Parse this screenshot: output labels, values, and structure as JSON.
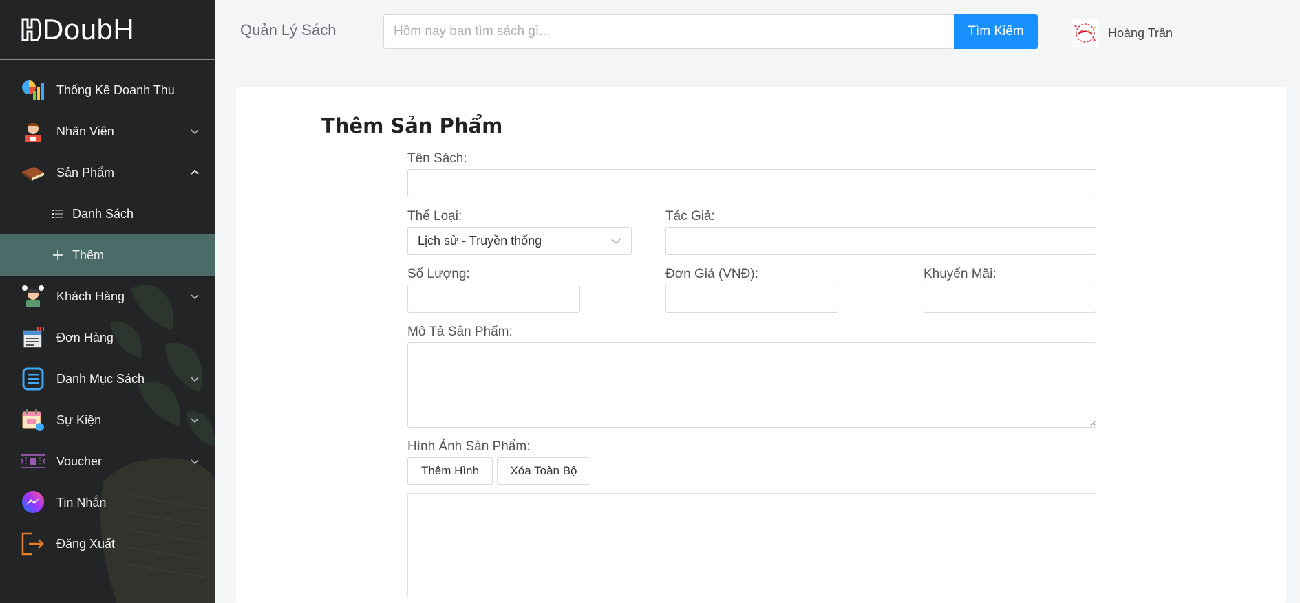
{
  "brand": {
    "name": "DoubH"
  },
  "sidebar": {
    "items": [
      {
        "label": "Thống Kê Doanh Thu",
        "icon": "chart-stats-icon",
        "has_chevron": false
      },
      {
        "label": "Nhân Viên",
        "icon": "employee-icon",
        "has_chevron": true,
        "chevron": "down"
      },
      {
        "label": "Sản Phẩm",
        "icon": "book-icon",
        "has_chevron": true,
        "chevron": "up"
      },
      {
        "label": "Khách Hàng",
        "icon": "customer-icon",
        "has_chevron": true,
        "chevron": "down"
      },
      {
        "label": "Đơn Hàng",
        "icon": "order-icon",
        "has_chevron": false
      },
      {
        "label": "Danh Mục Sách",
        "icon": "list-document-icon",
        "has_chevron": true,
        "chevron": "down"
      },
      {
        "label": "Sự Kiện",
        "icon": "calendar-event-icon",
        "has_chevron": true,
        "chevron": "down"
      },
      {
        "label": "Voucher",
        "icon": "ticket-icon",
        "has_chevron": true,
        "chevron": "down"
      },
      {
        "label": "Tin Nhắn",
        "icon": "messenger-icon",
        "has_chevron": false
      },
      {
        "label": "Đăng Xuất",
        "icon": "logout-icon",
        "has_chevron": false
      }
    ],
    "subitems": [
      {
        "label": "Danh Sách",
        "icon": "list-icon",
        "active": false
      },
      {
        "label": "Thêm",
        "icon": "plus-icon",
        "active": true
      }
    ],
    "active_color": "#4a6b68",
    "background": "#232426"
  },
  "header": {
    "title": "Quản Lý Sách",
    "search_placeholder": "Hôm nay bạn tìm sách gì...",
    "search_value": "",
    "search_button": "Tìm Kiếm",
    "user_name": "Hoàng Trần",
    "accent": "#1890ff"
  },
  "form": {
    "title": "Thêm Sản Phẩm",
    "book_name_label": "Tên Sách:",
    "book_name_value": "",
    "category_label": "Thể Loại:",
    "category_value": "Lịch sử - Truyền thống",
    "author_label": "Tác Giả:",
    "author_value": "",
    "quantity_label": "Số Lượng:",
    "quantity_value": "",
    "price_label": "Đơn Giá (VNĐ):",
    "price_value": "",
    "discount_label": "Khuyến Mãi:",
    "discount_value": "",
    "description_label": "Mô Tả Sản Phẩm:",
    "description_value": "",
    "images_label": "Hình Ảnh Sản Phẩm:",
    "add_image_button": "Thêm Hình",
    "clear_all_button": "Xóa Toàn Bộ"
  }
}
